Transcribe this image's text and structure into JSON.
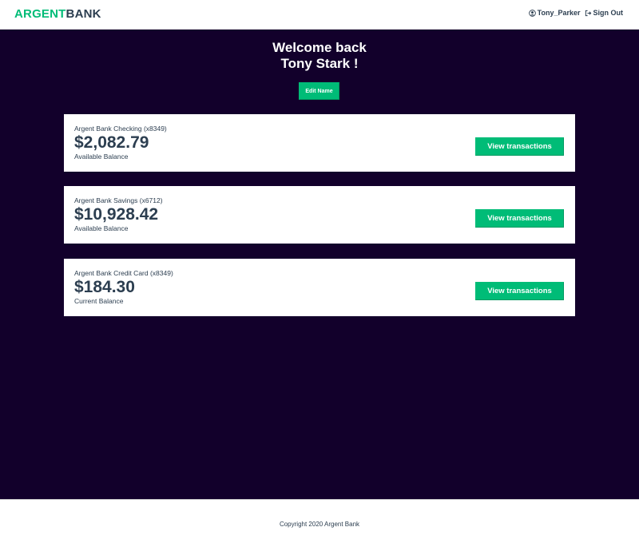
{
  "brand": {
    "logo_part1": "ARGENT",
    "logo_part2": "BANK",
    "accent_color": "#00bc77",
    "text_color": "#2c3e50",
    "main_bg": "#12002b"
  },
  "header": {
    "user_link": {
      "icon": "user-circle-icon",
      "label": "Tony_Parker"
    },
    "signout_link": {
      "icon": "sign-out-icon",
      "label": "Sign Out"
    }
  },
  "main": {
    "welcome_line1": "Welcome back",
    "welcome_line2": "Tony Stark !",
    "edit_button_label": "Edit Name",
    "accounts": [
      {
        "title": "Argent Bank Checking (x8349)",
        "amount": "$2,082.79",
        "description": "Available Balance",
        "button_label": "View transactions"
      },
      {
        "title": "Argent Bank Savings (x6712)",
        "amount": "$10,928.42",
        "description": "Available Balance",
        "button_label": "View transactions"
      },
      {
        "title": "Argent Bank Credit Card (x8349)",
        "amount": "$184.30",
        "description": "Current Balance",
        "button_label": "View transactions"
      }
    ]
  },
  "footer": {
    "copyright": "Copyright 2020 Argent Bank"
  }
}
